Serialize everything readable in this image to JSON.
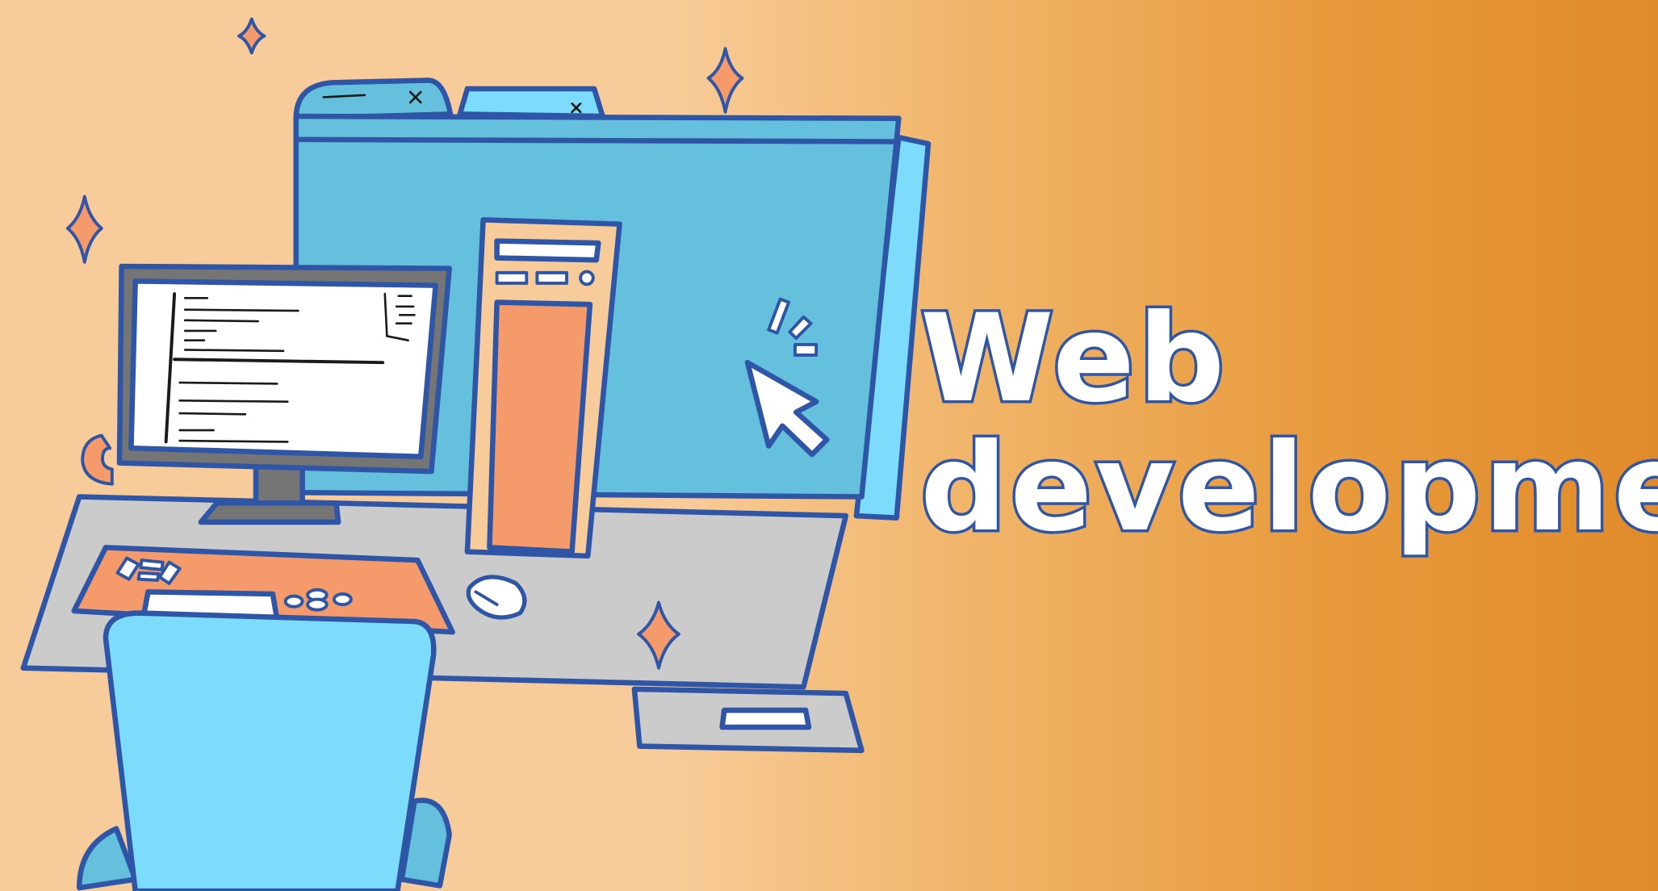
{
  "title": {
    "line1": "Web",
    "line2": "development"
  },
  "colors": {
    "background_left": "#f8cc9a",
    "background_right": "#e08b2b",
    "outline": "#2f56a6",
    "screen_blue": "#64c0dc",
    "light_blue": "#7ddcfb",
    "orange_accent": "#f59a6a",
    "desk_gray": "#cbcbcb",
    "title_fill": "#ffffff"
  },
  "icons": [
    "sparkle-icon",
    "cursor-arrow-icon",
    "close-x-icon",
    "mouse-icon"
  ]
}
